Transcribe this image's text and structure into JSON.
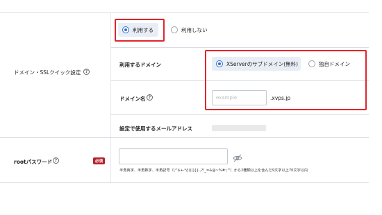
{
  "usage": {
    "options": [
      "利用する",
      "利用しない"
    ],
    "selected": "利用する"
  },
  "domain_section": {
    "label": "ドメイン・SSLクイック設定",
    "help_icon": "?"
  },
  "use_domain": {
    "label": "利用するドメイン",
    "options": [
      "XServerのサブドメイン(無料)",
      "独自ドメイン"
    ],
    "selected": "XServerのサブドメイン(無料)"
  },
  "domain_name": {
    "label": "ドメイン名",
    "placeholder": "example",
    "suffix": ".xvps.jp"
  },
  "mail": {
    "label": "設定で使用するメールアドレス"
  },
  "root_password": {
    "label": "rootパスワード",
    "required_badge": "必須",
    "value": "",
    "hint": "半角英字、半角数字、半角記号（\\^$+-*/|()[]{}.,?!_=&@~%#:;'\"）から2種類以上を含んだ9文字以上70文字以内"
  },
  "colors": {
    "highlight_border": "#e0242e",
    "radio_accent": "#2f6fd1",
    "required_badge": "#b3232b"
  }
}
